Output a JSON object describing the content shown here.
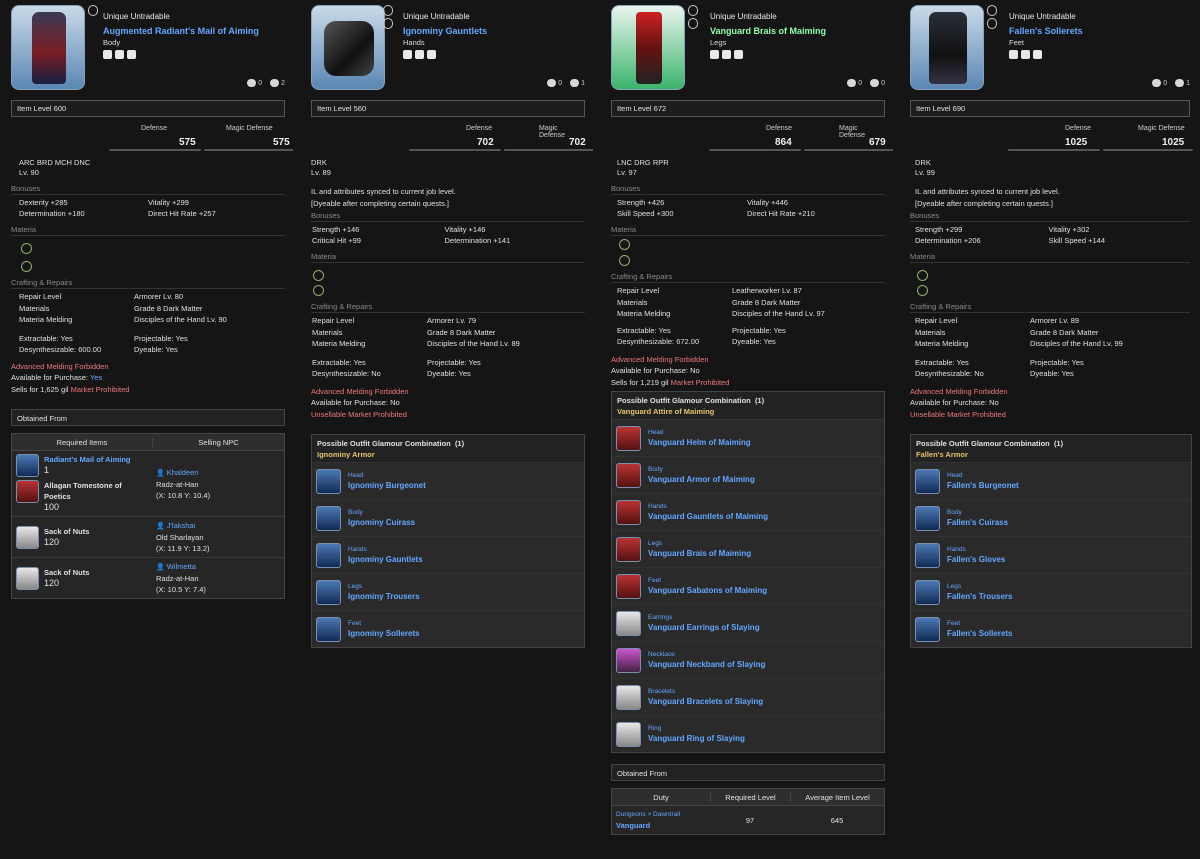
{
  "panels": [
    {
      "untradable": "Unique Untradable",
      "name": "Augmented Radiant's Mail of Aiming",
      "slot": "Body",
      "comments": "0",
      "lists": "2",
      "item_level": "Item Level 600",
      "defense_label": "Defense",
      "magic_defense_label": "Magic Defense",
      "defense": "575",
      "magic_defense": "575",
      "jobs": "ARC BRD MCH DNC",
      "level": "Lv. 90",
      "bonuses_label": "Bonuses",
      "bonuses": [
        "Dexterity +285",
        "Vitality +299",
        "Determination +180",
        "Direct Hit Rate +257"
      ],
      "materia_label": "Materia",
      "crafting_label": "Crafting & Repairs",
      "repair": [
        "Repair Level",
        "Armorer Lv. 80",
        "Materials",
        "Grade 8 Dark Matter",
        "Materia Melding",
        "Disciples of the Hand Lv. 90"
      ],
      "flags": [
        "Extractable: Yes",
        "Projectable: Yes",
        "Desynthesizable: 600.00",
        "Dyeable: Yes"
      ],
      "adv_meld": "Advanced Melding Forbidden",
      "purchase_label": "Available for Purchase:",
      "purchase_value": "Yes",
      "sells": "Sells for 1,625 gil",
      "market": "Market Prohibited",
      "obtained": "Obtained From",
      "table_headers": [
        "Required Items",
        "Selling NPC"
      ],
      "shop_rows": [
        {
          "items": [
            {
              "name": "Radiant's Mail of Aiming",
              "qty": "1"
            },
            {
              "name": "Allagan Tomestone of Poetics",
              "qty": "100"
            }
          ],
          "npc": "Khaldeen",
          "place": "Radz-at-Han",
          "coords": "(X: 10.8 Y: 10.4)"
        },
        {
          "items": [
            {
              "name": "Sack of Nuts",
              "qty": "120"
            }
          ],
          "npc": "J'lakshai",
          "place": "Old Sharlayan",
          "coords": "(X: 11.9 Y: 13.2)"
        },
        {
          "items": [
            {
              "name": "Sack of Nuts",
              "qty": "120"
            }
          ],
          "npc": "Wilmetta",
          "place": "Radz-at-Han",
          "coords": "(X: 10.5 Y: 7.4)"
        }
      ]
    },
    {
      "untradable": "Unique Untradable",
      "name": "Ignominy Gauntlets",
      "slot": "Hands",
      "comments": "0",
      "lists": "1",
      "item_level": "Item Level 560",
      "defense_label": "Defense",
      "magic_defense_label": "Magic Defense",
      "defense": "702",
      "magic_defense": "702",
      "jobs": "DRK",
      "level": "Lv. 89",
      "sync_note": "IL and attributes synced to current job level.",
      "dye_note": "[Dyeable after completing certain quests.]",
      "bonuses_label": "Bonuses",
      "bonuses": [
        "Strength +146",
        "Vitality +146",
        "Critical Hit +99",
        "Determination +141"
      ],
      "materia_label": "Materia",
      "crafting_label": "Crafting & Repairs",
      "repair": [
        "Repair Level",
        "Armorer Lv. 79",
        "Materials",
        "Grade 8 Dark Matter",
        "Materia Melding",
        "Disciples of the Hand Lv. 89"
      ],
      "flags": [
        "Extractable: Yes",
        "Projectable: Yes",
        "Desynthesizable: No",
        "Dyeable: Yes"
      ],
      "adv_meld": "Advanced Melding Forbidden",
      "purchase_label": "Available for Purchase:",
      "purchase_value": "No",
      "market": "Unsellable Market Prohibited",
      "outfit_title": "Possible Outfit Glamour Combination",
      "outfit_count": "(1)",
      "outfit_name": "Ignominy Armor",
      "outfit": [
        {
          "slot": "Head",
          "name": "Ignominy Burgeonet"
        },
        {
          "slot": "Body",
          "name": "Ignominy Cuirass"
        },
        {
          "slot": "Hands",
          "name": "Ignominy Gauntlets"
        },
        {
          "slot": "Legs",
          "name": "Ignominy Trousers"
        },
        {
          "slot": "Feet",
          "name": "Ignominy Sollerets"
        }
      ]
    },
    {
      "untradable": "Unique Untradable",
      "name": "Vanguard Brais of Maiming",
      "slot": "Legs",
      "comments": "0",
      "lists": "0",
      "item_level": "Item Level 672",
      "defense_label": "Defense",
      "magic_defense_label": "Magic Defense",
      "defense": "864",
      "magic_defense": "679",
      "jobs": "LNC DRG RPR",
      "level": "Lv. 97",
      "bonuses_label": "Bonuses",
      "bonuses": [
        "Strength +426",
        "Vitality +446",
        "Skill Speed +300",
        "Direct Hit Rate +210"
      ],
      "materia_label": "Materia",
      "crafting_label": "Crafting & Repairs",
      "repair": [
        "Repair Level",
        "Leatherworker Lv. 87",
        "Materials",
        "Grade 8 Dark Matter",
        "Materia Melding",
        "Disciples of the Hand Lv. 97"
      ],
      "flags": [
        "Extractable: Yes",
        "Projectable: Yes",
        "Desynthesizable: 672.00",
        "Dyeable: Yes"
      ],
      "adv_meld": "Advanced Melding Forbidden",
      "purchase_label": "Available for Purchase:",
      "purchase_value": "No",
      "sells": "Sells for 1,219 gil",
      "market": "Market Prohibited",
      "outfit_title": "Possible Outfit Glamour Combination",
      "outfit_count": "(1)",
      "outfit_name": "Vanguard Attire of Maiming",
      "outfit": [
        {
          "slot": "Head",
          "name": "Vanguard Helm of Maiming"
        },
        {
          "slot": "Body",
          "name": "Vanguard Armor of Maiming"
        },
        {
          "slot": "Hands",
          "name": "Vanguard Gauntlets of Maiming"
        },
        {
          "slot": "Legs",
          "name": "Vanguard Brais of Maiming"
        },
        {
          "slot": "Feet",
          "name": "Vanguard Sabatons of Maiming"
        },
        {
          "slot": "Earrings",
          "name": "Vanguard Earrings of Slaying"
        },
        {
          "slot": "Necklace",
          "name": "Vanguard Neckband of Slaying"
        },
        {
          "slot": "Bracelets",
          "name": "Vanguard Bracelets of Slaying"
        },
        {
          "slot": "Ring",
          "name": "Vanguard Ring of Slaying"
        }
      ],
      "obtained": "Obtained From",
      "duty_headers": [
        "Duty",
        "Required Level",
        "Average Item Level"
      ],
      "duty": {
        "path": "Dungeons > Dawntrail",
        "name": "Vanguard",
        "req": "97",
        "avg": "645"
      }
    },
    {
      "untradable": "Unique Untradable",
      "name": "Fallen's Sollerets",
      "slot": "Feet",
      "comments": "0",
      "lists": "1",
      "item_level": "Item Level 690",
      "defense_label": "Defense",
      "magic_defense_label": "Magic Defense",
      "defense": "1025",
      "magic_defense": "1025",
      "jobs": "DRK",
      "level": "Lv. 99",
      "sync_note": "IL and attributes synced to current job level.",
      "dye_note": "[Dyeable after completing certain quests.]",
      "bonuses_label": "Bonuses",
      "bonuses": [
        "Strength +299",
        "Vitality +302",
        "Determination +206",
        "Skill Speed +144"
      ],
      "materia_label": "Materia",
      "crafting_label": "Crafting & Repairs",
      "repair": [
        "Repair Level",
        "Armorer Lv. 89",
        "Materials",
        "Grade 8 Dark Matter",
        "Materia Melding",
        "Disciples of the Hand Lv. 99"
      ],
      "flags": [
        "Extractable: Yes",
        "Projectable: Yes",
        "Desynthesizable: No",
        "Dyeable: Yes"
      ],
      "adv_meld": "Advanced Melding Forbidden",
      "purchase_label": "Available for Purchase:",
      "purchase_value": "No",
      "market": "Unsellable Market Prohibited",
      "outfit_title": "Possible Outfit Glamour Combination",
      "outfit_count": "(1)",
      "outfit_name": "Fallen's Armor",
      "outfit": [
        {
          "slot": "Head",
          "name": "Fallen's Burgeonet"
        },
        {
          "slot": "Body",
          "name": "Fallen's Cuirass"
        },
        {
          "slot": "Hands",
          "name": "Fallen's Gloves"
        },
        {
          "slot": "Legs",
          "name": "Fallen's Trousers"
        },
        {
          "slot": "Feet",
          "name": "Fallen's Sollerets"
        }
      ]
    }
  ],
  "colors": {
    "item_name_blue": "#63a7ff",
    "item_name_green": "#90ffa8",
    "warning_red": "#ee7777",
    "outfit_gold": "#e6c36a"
  }
}
